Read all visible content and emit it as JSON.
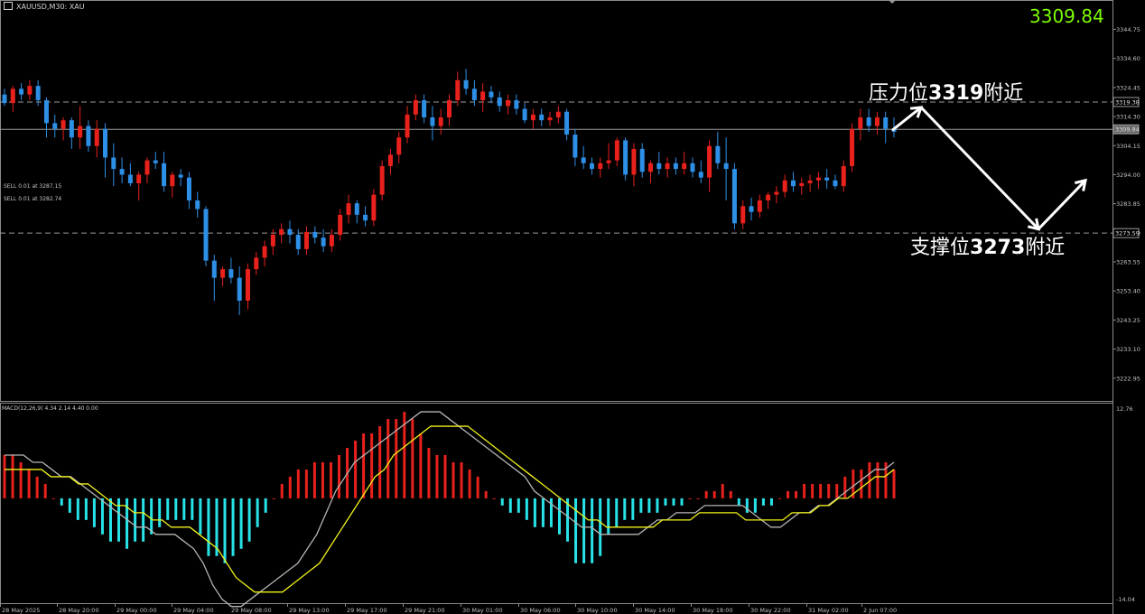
{
  "symbol_label": "XAUUSD,M30: XAU",
  "current_price": "3309.84",
  "orders": [
    "SELL 0.01 at 3287.15",
    "SELL 0.01 at 3282.74"
  ],
  "macd_label": "MACD(12,26,9) 4.34 2.14 4.40 0.00",
  "annotations": {
    "resistance_prefix": "压力位",
    "resistance_value": "3319",
    "resistance_suffix": "附近",
    "support_prefix": "支撑位",
    "support_value": "3273",
    "support_suffix": "附近"
  },
  "colors": {
    "bull": "#e8211c",
    "bear": "#2e8fe6",
    "hist_pos": "#e8211c",
    "hist_neg": "#27e3e8",
    "macd_line": "#b5b5b5",
    "signal_line": "#f2f21a",
    "price_label": "#7cfc00"
  },
  "chart_data": [
    {
      "type": "candlestick",
      "title": "",
      "ylim": [
        3215,
        3355
      ],
      "y_ticks": [
        "3344.75",
        "3334.60",
        "3324.45",
        "3314.30",
        "3304.15",
        "3294.00",
        "3283.85",
        "3273.70",
        "3263.55",
        "3253.40",
        "3243.25",
        "3233.10",
        "3222.95"
      ],
      "y_tick_values": [
        3344.75,
        3334.6,
        3324.45,
        3314.3,
        3304.15,
        3294.0,
        3283.85,
        3273.7,
        3263.55,
        3253.4,
        3243.25,
        3233.1,
        3222.95
      ],
      "price_boxes": [
        {
          "text": "3319.38",
          "value": 3319.38,
          "dashed_line": true
        },
        {
          "text": "3309.84",
          "value": 3309.84,
          "solid_line": true
        },
        {
          "text": "3273.59",
          "value": 3273.59,
          "dashed_line": true
        }
      ],
      "x_ticks": [
        "28 May 2025",
        "28 May 20:00",
        "29 May 00:00",
        "29 May 04:00",
        "29 May 08:00",
        "29 May 13:00",
        "29 May 17:00",
        "29 May 21:00",
        "30 May 01:00",
        "30 May 06:00",
        "30 May 10:00",
        "30 May 14:00",
        "30 May 18:00",
        "30 May 22:00",
        "31 May 02:00",
        "2 Jun 07:00"
      ],
      "candles": [
        [
          3322,
          3324,
          3318,
          3319
        ],
        [
          3319,
          3325,
          3316,
          3324
        ],
        [
          3324,
          3326,
          3320,
          3322
        ],
        [
          3322,
          3327,
          3320,
          3325
        ],
        [
          3325,
          3327,
          3318,
          3320
        ],
        [
          3320,
          3321,
          3307,
          3312
        ],
        [
          3312,
          3315,
          3307,
          3310
        ],
        [
          3310,
          3314,
          3306,
          3313
        ],
        [
          3313,
          3314,
          3303,
          3307
        ],
        [
          3307,
          3318,
          3303,
          3311
        ],
        [
          3311,
          3313,
          3302,
          3304
        ],
        [
          3304,
          3313,
          3300,
          3310
        ],
        [
          3310,
          3312,
          3293,
          3300
        ],
        [
          3300,
          3305,
          3290,
          3296
        ],
        [
          3296,
          3300,
          3291,
          3294
        ],
        [
          3294,
          3298,
          3290,
          3291
        ],
        [
          3291,
          3295,
          3285,
          3294
        ],
        [
          3294,
          3300,
          3291,
          3299
        ],
        [
          3299,
          3302,
          3296,
          3298
        ],
        [
          3298,
          3302,
          3288,
          3290
        ],
        [
          3290,
          3295,
          3286,
          3294
        ],
        [
          3294,
          3296,
          3290,
          3293
        ],
        [
          3293,
          3295,
          3282,
          3285
        ],
        [
          3285,
          3288,
          3279,
          3282
        ],
        [
          3282,
          3283,
          3262,
          3264
        ],
        [
          3264,
          3266,
          3250,
          3258
        ],
        [
          3258,
          3262,
          3255,
          3261
        ],
        [
          3261,
          3265,
          3256,
          3258
        ],
        [
          3258,
          3262,
          3245,
          3250
        ],
        [
          3250,
          3263,
          3247,
          3261
        ],
        [
          3261,
          3267,
          3259,
          3265
        ],
        [
          3265,
          3271,
          3262,
          3269
        ],
        [
          3269,
          3275,
          3266,
          3273
        ],
        [
          3273,
          3277,
          3270,
          3275
        ],
        [
          3275,
          3278,
          3270,
          3273
        ],
        [
          3273,
          3275,
          3266,
          3268
        ],
        [
          3268,
          3276,
          3266,
          3274
        ],
        [
          3274,
          3276,
          3270,
          3272
        ],
        [
          3272,
          3275,
          3267,
          3269
        ],
        [
          3269,
          3275,
          3267,
          3273
        ],
        [
          3273,
          3282,
          3271,
          3280
        ],
        [
          3280,
          3287,
          3277,
          3284
        ],
        [
          3284,
          3285,
          3277,
          3280
        ],
        [
          3280,
          3283,
          3276,
          3278
        ],
        [
          3278,
          3289,
          3276,
          3287
        ],
        [
          3287,
          3299,
          3285,
          3297
        ],
        [
          3297,
          3303,
          3294,
          3301
        ],
        [
          3301,
          3309,
          3298,
          3307
        ],
        [
          3307,
          3318,
          3305,
          3315
        ],
        [
          3315,
          3322,
          3313,
          3320
        ],
        [
          3320,
          3322,
          3312,
          3314
        ],
        [
          3314,
          3318,
          3306,
          3311
        ],
        [
          3311,
          3317,
          3308,
          3314
        ],
        [
          3314,
          3322,
          3311,
          3320
        ],
        [
          3320,
          3330,
          3318,
          3327
        ],
        [
          3327,
          3331,
          3322,
          3324
        ],
        [
          3324,
          3327,
          3318,
          3320
        ],
        [
          3320,
          3326,
          3316,
          3323
        ],
        [
          3323,
          3325,
          3319,
          3321
        ],
        [
          3321,
          3323,
          3316,
          3318
        ],
        [
          3318,
          3322,
          3315,
          3320
        ],
        [
          3320,
          3322,
          3315,
          3317
        ],
        [
          3317,
          3319,
          3312,
          3313
        ],
        [
          3313,
          3317,
          3310,
          3315
        ],
        [
          3315,
          3317,
          3311,
          3313
        ],
        [
          3313,
          3316,
          3311,
          3314
        ],
        [
          3314,
          3318,
          3312,
          3316
        ],
        [
          3316,
          3317,
          3306,
          3308
        ],
        [
          3308,
          3310,
          3297,
          3300
        ],
        [
          3300,
          3304,
          3296,
          3298
        ],
        [
          3298,
          3300,
          3294,
          3296
        ],
        [
          3296,
          3300,
          3293,
          3298
        ],
        [
          3298,
          3305,
          3296,
          3299
        ],
        [
          3299,
          3307,
          3297,
          3306
        ],
        [
          3306,
          3307,
          3292,
          3294
        ],
        [
          3294,
          3305,
          3290,
          3303
        ],
        [
          3303,
          3305,
          3293,
          3295
        ],
        [
          3295,
          3299,
          3291,
          3298
        ],
        [
          3298,
          3302,
          3294,
          3296
        ],
        [
          3296,
          3300,
          3293,
          3298
        ],
        [
          3298,
          3300,
          3294,
          3296
        ],
        [
          3296,
          3302,
          3294,
          3298
        ],
        [
          3298,
          3300,
          3293,
          3295
        ],
        [
          3295,
          3299,
          3291,
          3293
        ],
        [
          3293,
          3306,
          3288,
          3304
        ],
        [
          3304,
          3309,
          3296,
          3298
        ],
        [
          3298,
          3307,
          3285,
          3296
        ],
        [
          3296,
          3298,
          3275,
          3277
        ],
        [
          3277,
          3285,
          3275,
          3283
        ],
        [
          3283,
          3286,
          3278,
          3281
        ],
        [
          3281,
          3287,
          3279,
          3285
        ],
        [
          3285,
          3288,
          3282,
          3287
        ],
        [
          3287,
          3290,
          3284,
          3288
        ],
        [
          3288,
          3294,
          3286,
          3292
        ],
        [
          3292,
          3295,
          3288,
          3290
        ],
        [
          3290,
          3293,
          3287,
          3291
        ],
        [
          3291,
          3294,
          3288,
          3292
        ],
        [
          3292,
          3295,
          3289,
          3293
        ],
        [
          3293,
          3296,
          3289,
          3292
        ],
        [
          3292,
          3294,
          3289,
          3290
        ],
        [
          3290,
          3299,
          3288,
          3297
        ],
        [
          3297,
          3312,
          3295,
          3310
        ],
        [
          3310,
          3317,
          3306,
          3314
        ],
        [
          3314,
          3317,
          3309,
          3311
        ],
        [
          3311,
          3316,
          3308,
          3314
        ],
        [
          3314,
          3316,
          3305,
          3310
        ],
        [
          3310,
          3314,
          3307,
          3309
        ]
      ],
      "projection": {
        "points": [
          3309.5,
          3317.5,
          3275,
          3292
        ]
      }
    },
    {
      "type": "bar+line",
      "title": "",
      "ylim": [
        -14.04,
        12.76
      ],
      "y_ticks": [
        "12.76",
        "-14.04"
      ],
      "histogram": [
        6,
        6,
        5,
        4,
        3,
        2,
        0,
        -1,
        -2,
        -3,
        -3,
        -4,
        -5,
        -6,
        -6,
        -7,
        -6,
        -6,
        -5,
        -4,
        -3,
        -3,
        -3,
        -3,
        -5,
        -8,
        -8,
        -9,
        -8,
        -7,
        -6,
        -4,
        -2,
        0,
        2,
        3,
        4,
        4,
        5,
        5,
        5,
        6,
        7,
        8,
        9,
        9,
        10,
        11,
        11,
        12,
        11,
        9,
        7,
        6,
        6,
        5,
        5,
        4,
        3,
        1,
        0,
        -1,
        -2,
        -2,
        -3,
        -4,
        -4,
        -4,
        -5,
        -6,
        -9,
        -9,
        -9,
        -8,
        -5,
        -4,
        -3,
        -3,
        -2,
        -2,
        -2,
        -1,
        -1,
        -1,
        0,
        0,
        1,
        1,
        2,
        1,
        -1,
        -2,
        -2,
        -1,
        -1,
        0,
        1,
        1,
        2,
        2,
        2,
        2,
        2,
        3,
        4,
        4,
        5,
        5,
        5,
        4
      ],
      "macd_line": [
        6,
        6,
        6,
        5,
        5,
        4,
        3,
        3,
        2,
        1,
        0,
        -1,
        -2,
        -3,
        -4,
        -4,
        -5,
        -5,
        -5,
        -6,
        -7,
        -9,
        -12,
        -14,
        -15,
        -15,
        -14,
        -13,
        -12,
        -11,
        -10,
        -9,
        -7,
        -5,
        -2,
        1,
        3,
        5,
        6,
        7,
        8,
        9,
        10,
        11,
        12,
        12,
        12,
        11,
        10,
        9,
        8,
        7,
        6,
        5,
        4,
        3,
        1,
        0,
        -1,
        -2,
        -3,
        -4,
        -4,
        -5,
        -5,
        -5,
        -5,
        -5,
        -4,
        -3,
        -3,
        -2,
        -2,
        -2,
        -1,
        -1,
        -1,
        -1,
        -1,
        -2,
        -3,
        -4,
        -4,
        -3,
        -2,
        -2,
        -1,
        -1,
        0,
        1,
        2,
        3,
        4,
        4,
        5
      ],
      "signal_line": [
        4,
        4,
        4,
        4,
        4,
        3,
        3,
        3,
        2,
        2,
        1,
        0,
        -1,
        -1,
        -2,
        -2,
        -3,
        -3,
        -4,
        -4,
        -4,
        -5,
        -6,
        -7,
        -9,
        -11,
        -12,
        -13,
        -13,
        -13,
        -13,
        -12,
        -11,
        -10,
        -9,
        -7,
        -5,
        -3,
        -1,
        1,
        3,
        4,
        6,
        7,
        8,
        9,
        10,
        10,
        10,
        10,
        10,
        9,
        8,
        7,
        6,
        5,
        4,
        3,
        2,
        1,
        0,
        -1,
        -2,
        -3,
        -3,
        -4,
        -4,
        -4,
        -4,
        -4,
        -4,
        -3,
        -3,
        -3,
        -3,
        -2,
        -2,
        -2,
        -2,
        -2,
        -3,
        -3,
        -3,
        -3,
        -3,
        -2,
        -2,
        -2,
        -1,
        -1,
        0,
        0,
        1,
        2,
        3,
        3,
        4
      ]
    }
  ]
}
